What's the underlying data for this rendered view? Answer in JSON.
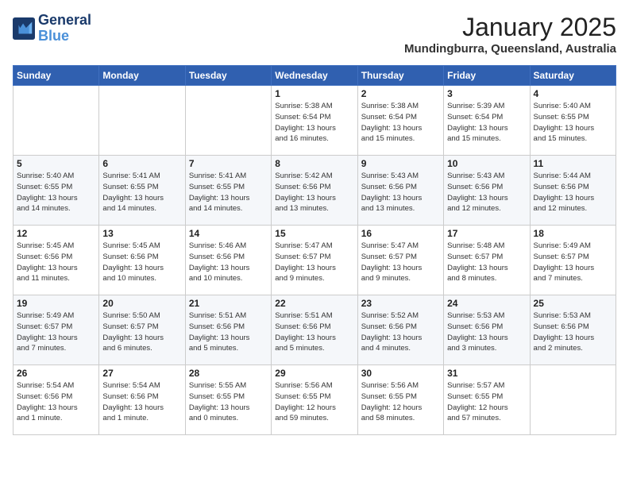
{
  "header": {
    "logo_line1": "General",
    "logo_line2": "Blue",
    "month": "January 2025",
    "location": "Mundingburra, Queensland, Australia"
  },
  "days_of_week": [
    "Sunday",
    "Monday",
    "Tuesday",
    "Wednesday",
    "Thursday",
    "Friday",
    "Saturday"
  ],
  "weeks": [
    [
      {
        "day": "",
        "info": ""
      },
      {
        "day": "",
        "info": ""
      },
      {
        "day": "",
        "info": ""
      },
      {
        "day": "1",
        "info": "Sunrise: 5:38 AM\nSunset: 6:54 PM\nDaylight: 13 hours\nand 16 minutes."
      },
      {
        "day": "2",
        "info": "Sunrise: 5:38 AM\nSunset: 6:54 PM\nDaylight: 13 hours\nand 15 minutes."
      },
      {
        "day": "3",
        "info": "Sunrise: 5:39 AM\nSunset: 6:54 PM\nDaylight: 13 hours\nand 15 minutes."
      },
      {
        "day": "4",
        "info": "Sunrise: 5:40 AM\nSunset: 6:55 PM\nDaylight: 13 hours\nand 15 minutes."
      }
    ],
    [
      {
        "day": "5",
        "info": "Sunrise: 5:40 AM\nSunset: 6:55 PM\nDaylight: 13 hours\nand 14 minutes."
      },
      {
        "day": "6",
        "info": "Sunrise: 5:41 AM\nSunset: 6:55 PM\nDaylight: 13 hours\nand 14 minutes."
      },
      {
        "day": "7",
        "info": "Sunrise: 5:41 AM\nSunset: 6:55 PM\nDaylight: 13 hours\nand 14 minutes."
      },
      {
        "day": "8",
        "info": "Sunrise: 5:42 AM\nSunset: 6:56 PM\nDaylight: 13 hours\nand 13 minutes."
      },
      {
        "day": "9",
        "info": "Sunrise: 5:43 AM\nSunset: 6:56 PM\nDaylight: 13 hours\nand 13 minutes."
      },
      {
        "day": "10",
        "info": "Sunrise: 5:43 AM\nSunset: 6:56 PM\nDaylight: 13 hours\nand 12 minutes."
      },
      {
        "day": "11",
        "info": "Sunrise: 5:44 AM\nSunset: 6:56 PM\nDaylight: 13 hours\nand 12 minutes."
      }
    ],
    [
      {
        "day": "12",
        "info": "Sunrise: 5:45 AM\nSunset: 6:56 PM\nDaylight: 13 hours\nand 11 minutes."
      },
      {
        "day": "13",
        "info": "Sunrise: 5:45 AM\nSunset: 6:56 PM\nDaylight: 13 hours\nand 10 minutes."
      },
      {
        "day": "14",
        "info": "Sunrise: 5:46 AM\nSunset: 6:56 PM\nDaylight: 13 hours\nand 10 minutes."
      },
      {
        "day": "15",
        "info": "Sunrise: 5:47 AM\nSunset: 6:57 PM\nDaylight: 13 hours\nand 9 minutes."
      },
      {
        "day": "16",
        "info": "Sunrise: 5:47 AM\nSunset: 6:57 PM\nDaylight: 13 hours\nand 9 minutes."
      },
      {
        "day": "17",
        "info": "Sunrise: 5:48 AM\nSunset: 6:57 PM\nDaylight: 13 hours\nand 8 minutes."
      },
      {
        "day": "18",
        "info": "Sunrise: 5:49 AM\nSunset: 6:57 PM\nDaylight: 13 hours\nand 7 minutes."
      }
    ],
    [
      {
        "day": "19",
        "info": "Sunrise: 5:49 AM\nSunset: 6:57 PM\nDaylight: 13 hours\nand 7 minutes."
      },
      {
        "day": "20",
        "info": "Sunrise: 5:50 AM\nSunset: 6:57 PM\nDaylight: 13 hours\nand 6 minutes."
      },
      {
        "day": "21",
        "info": "Sunrise: 5:51 AM\nSunset: 6:56 PM\nDaylight: 13 hours\nand 5 minutes."
      },
      {
        "day": "22",
        "info": "Sunrise: 5:51 AM\nSunset: 6:56 PM\nDaylight: 13 hours\nand 5 minutes."
      },
      {
        "day": "23",
        "info": "Sunrise: 5:52 AM\nSunset: 6:56 PM\nDaylight: 13 hours\nand 4 minutes."
      },
      {
        "day": "24",
        "info": "Sunrise: 5:53 AM\nSunset: 6:56 PM\nDaylight: 13 hours\nand 3 minutes."
      },
      {
        "day": "25",
        "info": "Sunrise: 5:53 AM\nSunset: 6:56 PM\nDaylight: 13 hours\nand 2 minutes."
      }
    ],
    [
      {
        "day": "26",
        "info": "Sunrise: 5:54 AM\nSunset: 6:56 PM\nDaylight: 13 hours\nand 1 minute."
      },
      {
        "day": "27",
        "info": "Sunrise: 5:54 AM\nSunset: 6:56 PM\nDaylight: 13 hours\nand 1 minute."
      },
      {
        "day": "28",
        "info": "Sunrise: 5:55 AM\nSunset: 6:55 PM\nDaylight: 13 hours\nand 0 minutes."
      },
      {
        "day": "29",
        "info": "Sunrise: 5:56 AM\nSunset: 6:55 PM\nDaylight: 12 hours\nand 59 minutes."
      },
      {
        "day": "30",
        "info": "Sunrise: 5:56 AM\nSunset: 6:55 PM\nDaylight: 12 hours\nand 58 minutes."
      },
      {
        "day": "31",
        "info": "Sunrise: 5:57 AM\nSunset: 6:55 PM\nDaylight: 12 hours\nand 57 minutes."
      },
      {
        "day": "",
        "info": ""
      }
    ]
  ]
}
